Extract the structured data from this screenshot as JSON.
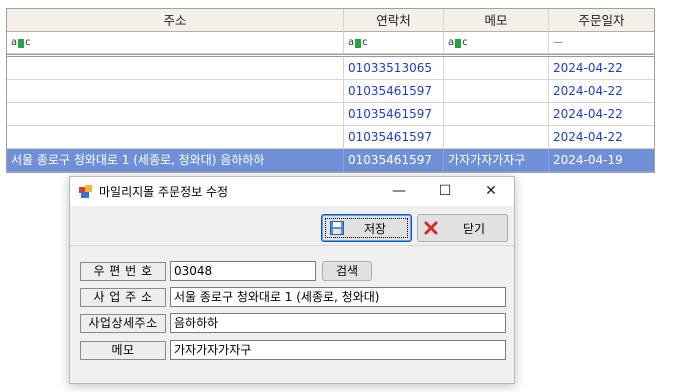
{
  "grid": {
    "columns": [
      "주소",
      "연락처",
      "메모",
      "주문일자"
    ],
    "filter": {
      "fx_label": "=",
      "dash": "—"
    },
    "rows": [
      {
        "address": "",
        "phone": "01033513065",
        "memo": "",
        "date": "2024-04-22"
      },
      {
        "address": "",
        "phone": "01035461597",
        "memo": "",
        "date": "2024-04-22"
      },
      {
        "address": "",
        "phone": "01035461597",
        "memo": "",
        "date": "2024-04-22"
      },
      {
        "address": "",
        "phone": "01035461597",
        "memo": "",
        "date": "2024-04-22"
      },
      {
        "address": "서울 종로구 청와대로 1 (세종로, 청와대) 음하하하",
        "phone": "01035461597",
        "memo": "가자가자가자구",
        "date": "2024-04-19"
      }
    ]
  },
  "dialog": {
    "title": "마일리지몰 주문정보 수정",
    "minimize": "—",
    "maximize": "☐",
    "close": "✕",
    "save_label": "저장",
    "close_label": "닫기",
    "search_label": "검색",
    "fields": {
      "zip_label": "우 편 번 호",
      "zip_value": "03048",
      "address_label": "사 업 주 소",
      "address_value": "서울 종로구 청와대로 1 (세종로, 청와대)",
      "detail_label": "사업상세주소",
      "detail_value": "음하하하",
      "memo_label": "메모",
      "memo_value": "가자가자가자구"
    }
  },
  "colors": {
    "link_blue": "#1f3ec2",
    "selection": "#6f8fd6",
    "header_bg": "#f4f0e9"
  },
  "icons": [
    "filter-fx-icon",
    "app-icon",
    "save-disk-icon",
    "close-x-icon"
  ]
}
